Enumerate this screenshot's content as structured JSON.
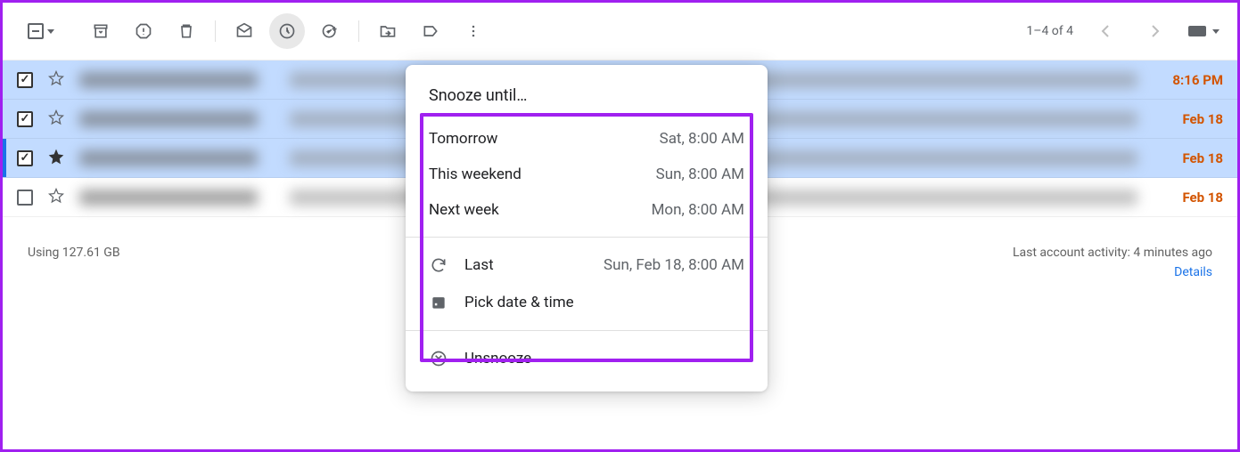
{
  "toolbar": {
    "pagination": "1–4 of 4"
  },
  "emails": [
    {
      "selected": true,
      "starred": false,
      "starFilled": false,
      "time": "8:16 PM",
      "accent": false
    },
    {
      "selected": true,
      "starred": false,
      "starFilled": false,
      "time": "Feb 18",
      "accent": false
    },
    {
      "selected": true,
      "starred": false,
      "starFilled": true,
      "time": "Feb 18",
      "accent": true
    },
    {
      "selected": false,
      "starred": false,
      "starFilled": false,
      "time": "Feb 18",
      "accent": false
    }
  ],
  "snooze": {
    "title": "Snooze until…",
    "options": [
      {
        "label": "Tomorrow",
        "when": "Sat, 8:00 AM"
      },
      {
        "label": "This weekend",
        "when": "Sun, 8:00 AM"
      },
      {
        "label": "Next week",
        "when": "Mon, 8:00 AM"
      }
    ],
    "last": {
      "label": "Last",
      "when": "Sun, Feb 18, 8:00 AM"
    },
    "pick": "Pick date & time",
    "unsnooze": "Unsnooze"
  },
  "footer": {
    "storage": "Using 127.61 GB",
    "activity": "Last account activity: 4 minutes ago",
    "details": "Details"
  }
}
